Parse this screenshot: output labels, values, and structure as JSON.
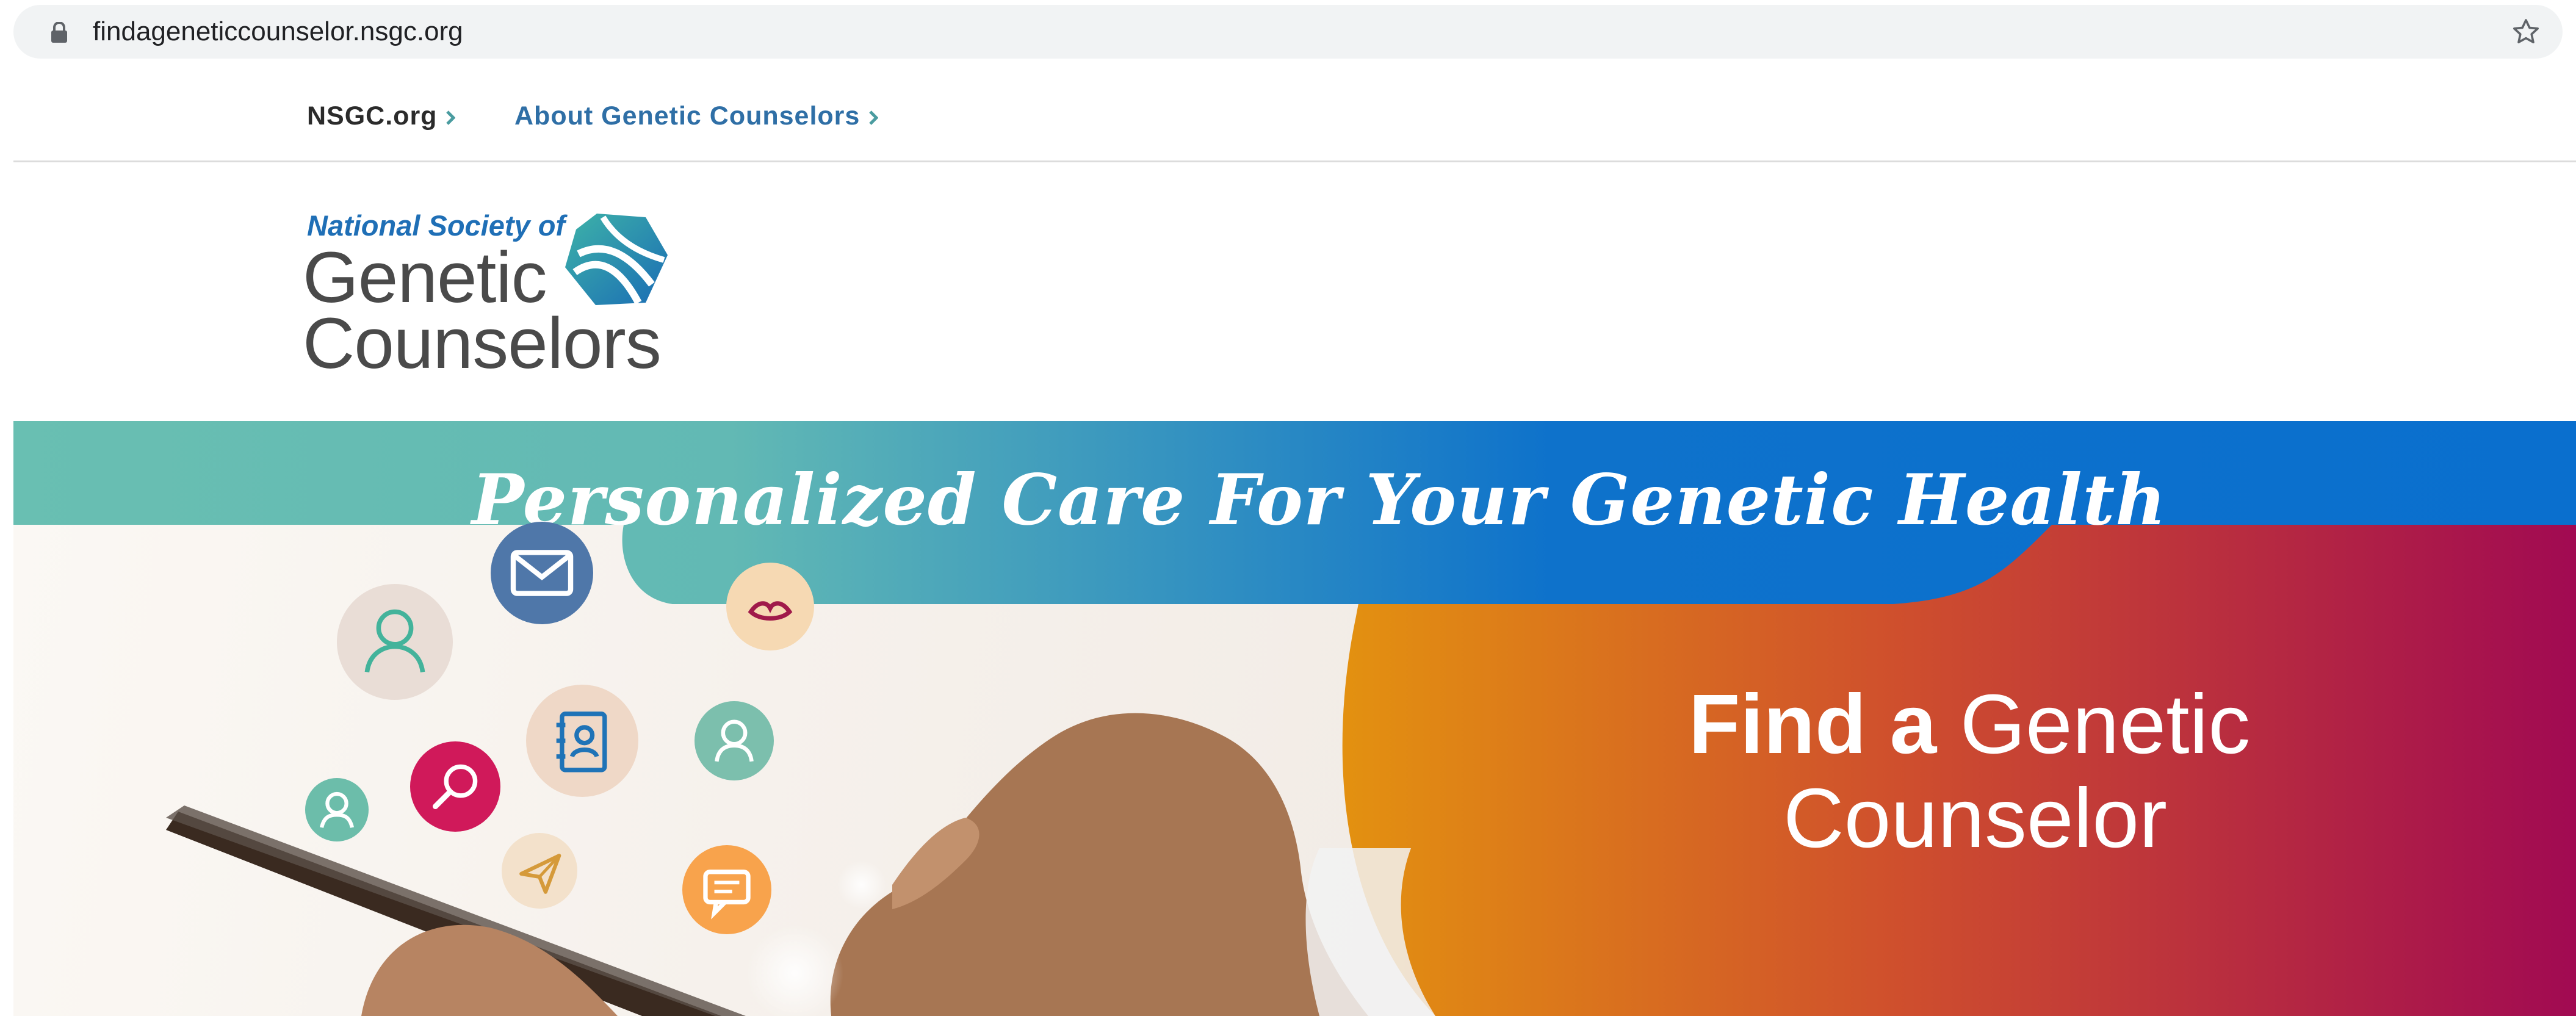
{
  "browser": {
    "url": "findageneticcounselor.nsgc.org",
    "lock_icon": "lock-icon",
    "bookmark_icon": "star-icon"
  },
  "topnav": {
    "links": [
      {
        "label": "NSGC.org",
        "icon": "chevron-right-icon",
        "color": "#2b2b2b"
      },
      {
        "label": "About Genetic Counselors",
        "icon": "chevron-right-icon",
        "color": "#2f6fa6"
      }
    ]
  },
  "logo": {
    "line1": "National Society of",
    "line2": "Genetic",
    "line3": "Counselors",
    "mark_icon": "dna-hexagon-logo"
  },
  "hero": {
    "tagline": "Personalized Care For Your Genetic Health",
    "headline_bold": "Find a",
    "headline_rest": "Genetic",
    "headline_line2": "Counselor",
    "icons": [
      "mail-icon",
      "user-icon",
      "hands-icon",
      "address-book-icon",
      "magnifier-icon",
      "user-icon",
      "user-female-icon",
      "paper-plane-icon",
      "chat-icon"
    ],
    "colors": {
      "teal": "#68bdb1",
      "blue": "#0b72c9",
      "orange": "#e1900f",
      "magenta": "#a30c4e"
    }
  }
}
